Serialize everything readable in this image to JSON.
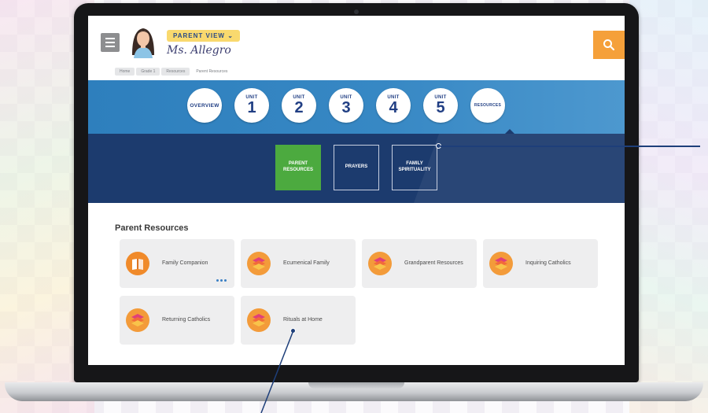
{
  "header": {
    "badge": "PARENT VIEW",
    "user_name": "Ms. Allegro",
    "search_label": "Search"
  },
  "breadcrumb": [
    "Home",
    "Grade 1",
    "Resources",
    "Parent Resources"
  ],
  "units": {
    "overview": "OVERVIEW",
    "unit_word": "UNIT",
    "items": [
      "1",
      "2",
      "3",
      "4",
      "5"
    ],
    "resources": "RESOURCES"
  },
  "sub_tabs": [
    {
      "label": "PARENT RESOURCES",
      "active": true
    },
    {
      "label": "PRAYERS",
      "active": false
    },
    {
      "label": "FAMILY SPIRITUALITY",
      "active": false
    }
  ],
  "section": {
    "title": "Parent Resources",
    "cards": [
      {
        "label": "Family Companion",
        "icon": "book-icon"
      },
      {
        "label": "Ecumenical Family",
        "icon": "stack-icon"
      },
      {
        "label": "Grandparent Resources",
        "icon": "stack-icon"
      },
      {
        "label": "Inquiring Catholics",
        "icon": "stack-icon"
      },
      {
        "label": "Returning Catholics",
        "icon": "stack-icon"
      },
      {
        "label": "Rituals at Home",
        "icon": "stack-icon"
      }
    ]
  },
  "colors": {
    "unit_band": "#3788c4",
    "sub_band": "#1c3b6e",
    "active_tab": "#4caa3f",
    "search": "#f5a03a",
    "badge": "#f9d96e"
  }
}
